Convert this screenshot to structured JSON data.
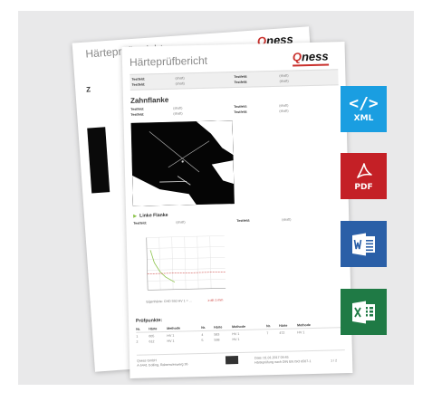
{
  "report": {
    "title": "Härteprüfbericht",
    "logo_q": "Q",
    "logo_rest": "ness",
    "meta_rows": [
      {
        "k1": "Testfeld:",
        "v1": "(shaft)",
        "k2": "Testfeld:",
        "v2": "(shaft)"
      },
      {
        "k1": "Testfeld:",
        "v1": "(shaft)",
        "k2": "Testfeld:",
        "v2": "(shaft)"
      }
    ],
    "section_title": "Zahnflanke",
    "section_rows": [
      {
        "k1": "Testfeld:",
        "v1": "(shaft)",
        "k2": "Testfeld:",
        "v2": "(shaft)"
      },
      {
        "k1": "Testfeld:",
        "v1": "(shaft)",
        "k2": "Testfeld:",
        "v2": "(shaft)"
      }
    ],
    "sub_title": "Linke Flanke",
    "sub_row": {
      "k1": "Testfeld:",
      "v1": "(shaft)",
      "k2": "Testfeld:",
      "v2": "(shaft)"
    },
    "chart_caption_left": "Eigenhärte: CHD 550 HV 1 = ...",
    "chart_caption_right": "≥ ah 1 mm",
    "table_title": "Prüfpunkte:",
    "table_headers": [
      "Nr.",
      "Härte",
      "Methode",
      "Nr.",
      "Härte",
      "Methode",
      "Nr.",
      "Härte",
      "Methode"
    ],
    "table_rows": [
      [
        "1",
        "605",
        "HV 1",
        "4",
        "583",
        "HV 1",
        "7",
        "472",
        "HV 1"
      ],
      [
        "2",
        "612",
        "HV 1",
        "5",
        "598",
        "HV 1",
        "",
        "",
        ""
      ]
    ],
    "footer_left_1": "Qness GmbH",
    "footer_left_2": "A-5441 Golling, Rabenwieswerg 36",
    "footer_mid_1": "Date: 01.01.2017 09:45",
    "footer_mid_2": "Härteprüfung nach DIN EN ISO 6507-1",
    "footer_page": "1 / 2"
  },
  "back_report": {
    "title": "Härteprüfbericht",
    "logo_q": "Q",
    "logo_rest": "ness",
    "section_initial": "Z"
  },
  "badges": {
    "xml": {
      "glyph": "</>",
      "label": "XML",
      "color": "#1a9ee1"
    },
    "pdf": {
      "label": "PDF",
      "color": "#c42026"
    },
    "word": {
      "color": "#2a5fa7"
    },
    "excel": {
      "color": "#1f7a45"
    }
  }
}
